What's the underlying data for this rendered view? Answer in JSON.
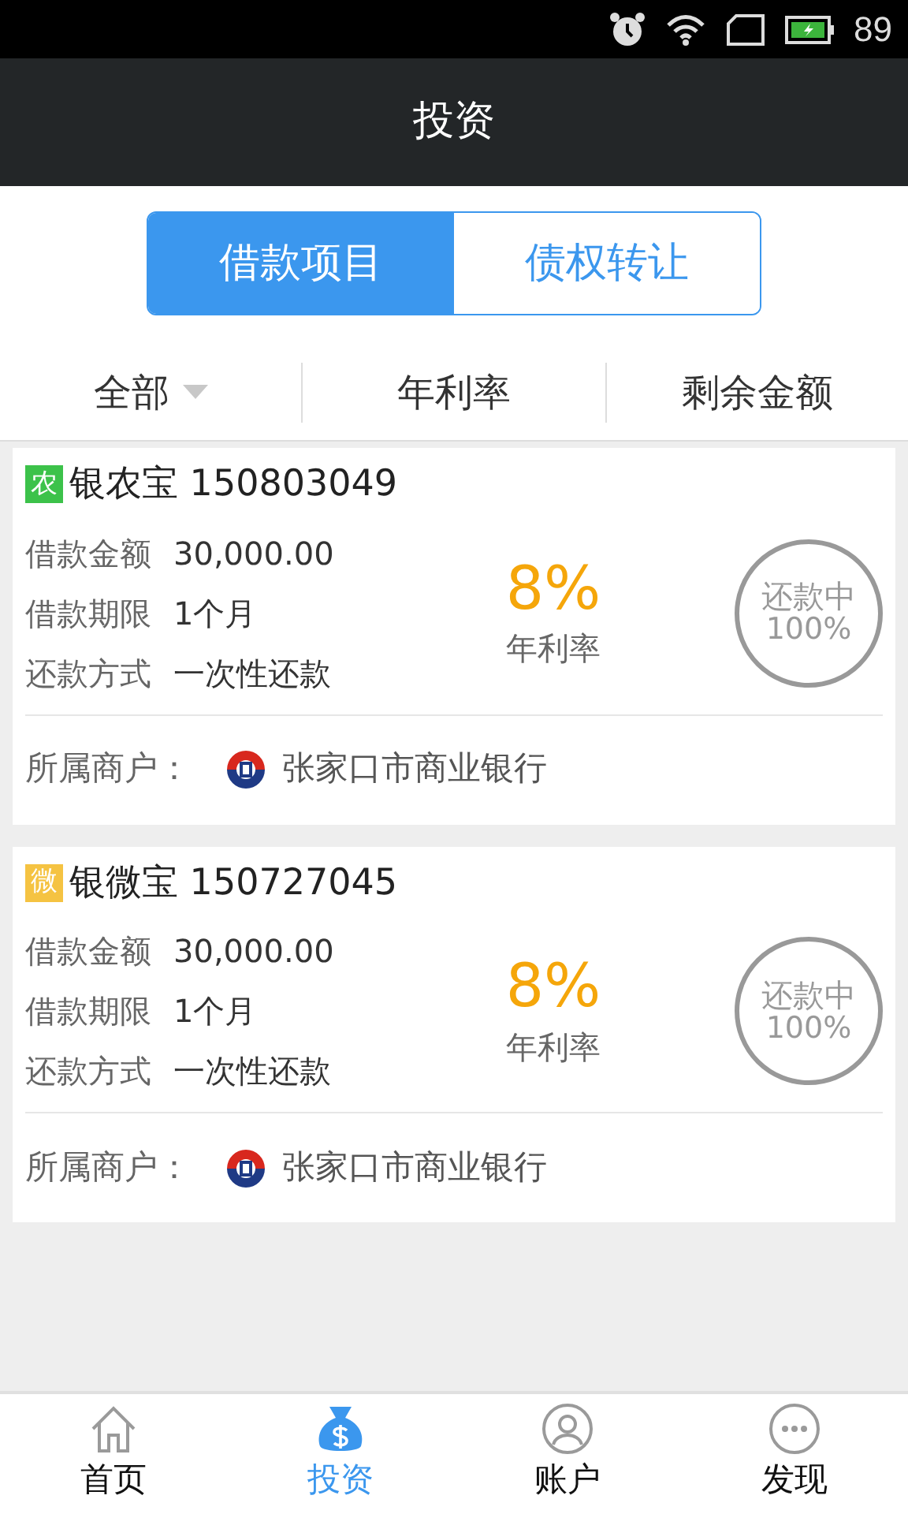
{
  "status_bar": {
    "battery": "89"
  },
  "header": {
    "title": "投资"
  },
  "segments": [
    {
      "label": "借款项目",
      "selected": true
    },
    {
      "label": "债权转让",
      "selected": false
    }
  ],
  "filters": [
    {
      "label": "全部",
      "dropdown": true
    },
    {
      "label": "年利率",
      "dropdown": false
    },
    {
      "label": "剩余金额",
      "dropdown": false
    }
  ],
  "loans": [
    {
      "badge": "农",
      "color": "#3cc24a",
      "name": "银农宝 150803049",
      "fields": [
        {
          "label": "借款金额",
          "value": "30,000.00"
        },
        {
          "label": "借款期限",
          "value": "1个月"
        },
        {
          "label": "还款方式",
          "value": "一次性还款"
        }
      ],
      "rate": "8%",
      "rate_label": "年利率",
      "status": "还款中",
      "progress": "100%",
      "merchant_label": "所属商户：",
      "merchant": "张家口市商业银行"
    },
    {
      "badge": "微",
      "color": "#f5c342",
      "name": "银微宝 150727045",
      "fields": [
        {
          "label": "借款金额",
          "value": "30,000.00"
        },
        {
          "label": "借款期限",
          "value": "1个月"
        },
        {
          "label": "还款方式",
          "value": "一次性还款"
        }
      ],
      "rate": "8%",
      "rate_label": "年利率",
      "status": "还款中",
      "progress": "100%",
      "merchant_label": "所属商户：",
      "merchant": "张家口市商业银行"
    }
  ],
  "nav": [
    {
      "kind": "home",
      "label": "首页",
      "selected": false
    },
    {
      "kind": "invest",
      "label": "投资",
      "selected": true
    },
    {
      "kind": "account",
      "label": "账户",
      "selected": false
    },
    {
      "kind": "discover",
      "label": "发现",
      "selected": false
    }
  ]
}
